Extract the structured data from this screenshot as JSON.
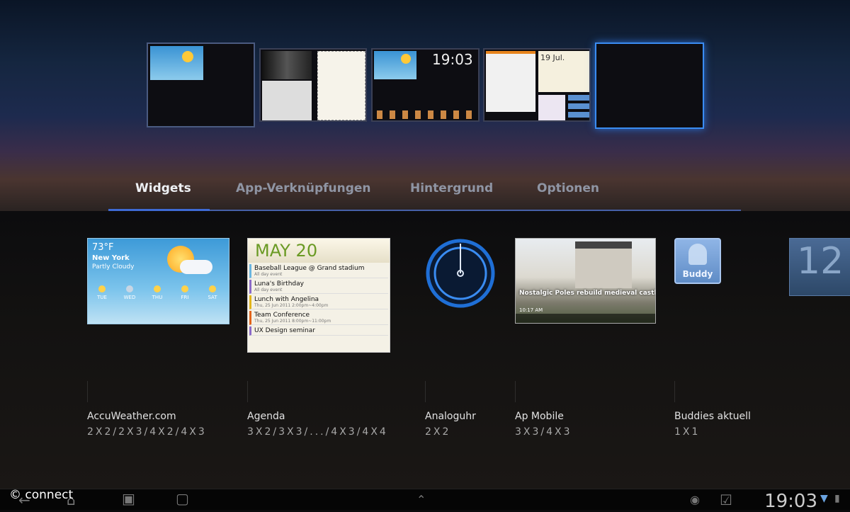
{
  "home_screens": [
    {
      "time": ""
    },
    {
      "time": ""
    },
    {
      "time": "19:03"
    },
    {
      "date": "19 Jul."
    },
    {
      "time": ""
    }
  ],
  "tabs": [
    {
      "label": "Widgets",
      "selected": true
    },
    {
      "label": "App-Verknüpfungen",
      "selected": false
    },
    {
      "label": "Hintergrund",
      "selected": false
    },
    {
      "label": "Optionen",
      "selected": false
    }
  ],
  "widgets": [
    {
      "name": "AccuWeather.com",
      "sizes": "2X2/2X3/4X2/4X3",
      "preview": {
        "temp": "73°F",
        "city": "New York",
        "cond": "Partly Cloudy",
        "days": [
          "TUE",
          "WED",
          "THU",
          "FRI",
          "SAT"
        ]
      }
    },
    {
      "name": "Agenda",
      "sizes": "3X2/3X3/.../4X3/4X4",
      "preview": {
        "date": "MAY 20",
        "events": [
          {
            "title": "Baseball League @ Grand stadium",
            "sub": "All day event"
          },
          {
            "title": "Luna's Birthday",
            "sub": "All day event"
          },
          {
            "title": "Lunch with Angelina",
            "sub": "Thu, 25 Jun 2011 2:00pm~4:00pm"
          },
          {
            "title": "Team Conference",
            "sub": "Thu, 25 Jun 2011 8:00pm~11:00pm"
          },
          {
            "title": "UX Design seminar",
            "sub": ""
          }
        ]
      }
    },
    {
      "name": "Analoguhr",
      "sizes": "2X2"
    },
    {
      "name": "Ap Mobile",
      "sizes": "3X3/4X3",
      "preview": {
        "headline": "Nostalgic Poles rebuild medieval castles",
        "time": "10:17 AM"
      }
    },
    {
      "name": "Buddies aktuell",
      "sizes": "1X1",
      "preview": {
        "label": "Buddy"
      }
    }
  ],
  "partial_widget": {
    "text": "12"
  },
  "status_bar": {
    "time": "19:03"
  },
  "watermark": "© connect",
  "colors": {
    "accent": "#3e6ad4",
    "active_screen": "#3a8cf2"
  },
  "icons": [
    "back-icon",
    "home-icon",
    "recent-apps-icon",
    "screenshot-icon",
    "up-arrow-icon",
    "notification-icon",
    "battery-icon",
    "wifi-icon"
  ]
}
